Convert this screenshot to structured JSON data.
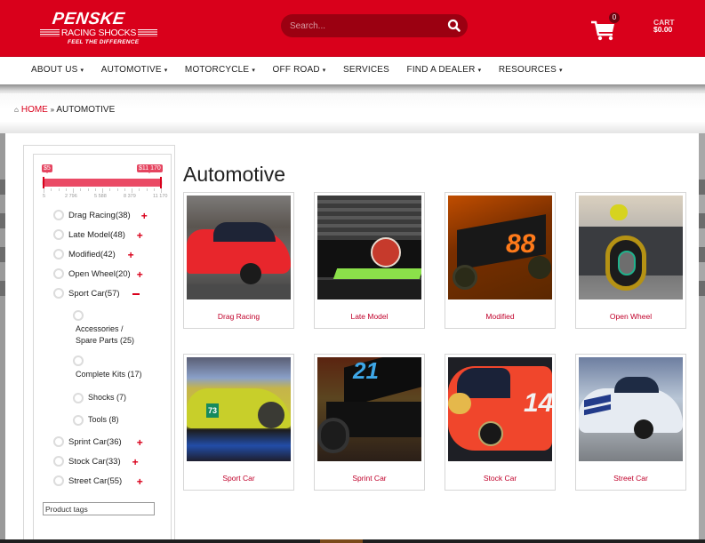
{
  "header": {
    "logo": {
      "brand": "PENSKE",
      "sub": "RACING SHOCKS",
      "tagline": "FEEL THE DIFFERENCE"
    },
    "search": {
      "placeholder": "Search...",
      "icon": "search-icon"
    },
    "cart": {
      "icon": "cart-icon",
      "count": "0",
      "label": "CART",
      "total": "$0.00"
    }
  },
  "nav": {
    "items": [
      {
        "label": "ABOUT US",
        "dropdown": true
      },
      {
        "label": "AUTOMOTIVE",
        "dropdown": true
      },
      {
        "label": "MOTORCYCLE",
        "dropdown": true
      },
      {
        "label": "OFF ROAD",
        "dropdown": true
      },
      {
        "label": "SERVICES",
        "dropdown": false
      },
      {
        "label": "FIND A DEALER",
        "dropdown": true
      },
      {
        "label": "RESOURCES",
        "dropdown": true
      }
    ],
    "caret": "▾"
  },
  "breadcrumb": {
    "icon": "home-icon",
    "home": "HOME",
    "separator": "»",
    "current": "AUTOMOTIVE"
  },
  "sidebar": {
    "price_filter": {
      "min_label": "$5",
      "max_label": "$11 170",
      "range_min": 5,
      "range_max": 11170,
      "selected_min_fraction": 0,
      "selected_max_fraction": 1,
      "tick_labels": [
        "5",
        "2 796",
        "5 588",
        "8 379",
        "11 170"
      ]
    },
    "categories": [
      {
        "label": "Drag Racing",
        "count": "(38)",
        "toggle": "+"
      },
      {
        "label": "Late Model",
        "count": "(48)",
        "toggle": "+"
      },
      {
        "label": "Modified",
        "count": "(42)",
        "toggle": "+"
      },
      {
        "label": "Open Wheel",
        "count": "(20)",
        "toggle": "+"
      },
      {
        "label": "Sport Car",
        "count": "(57)",
        "toggle": "−",
        "expanded": true
      }
    ],
    "subcategories": [
      {
        "label_line1": "Accessories /",
        "label_line2": "Spare Parts (25)"
      },
      {
        "label_line1": "Complete Kits (17)"
      },
      {
        "label_line1": "Shocks (7)"
      },
      {
        "label_line1": "Tools (8)"
      }
    ],
    "categories_after": [
      {
        "label": "Sprint Car",
        "count": "(36)",
        "toggle": "+"
      },
      {
        "label": "Stock Car",
        "count": "(33)",
        "toggle": "+"
      },
      {
        "label": "Street Car",
        "count": "(55)",
        "toggle": "+"
      }
    ],
    "tags_placeholder": "Product tags"
  },
  "main": {
    "title": "Automotive",
    "products": [
      {
        "name": "Drag Racing",
        "image": "red drag racing car"
      },
      {
        "name": "Late Model",
        "image": "black and green late model car"
      },
      {
        "name": "Modified",
        "image": "black and orange modified #88"
      },
      {
        "name": "Open Wheel",
        "image": "silver F1 open wheel car"
      },
      {
        "name": "Sport Car",
        "image": "yellow sport car #73"
      },
      {
        "name": "Sprint Car",
        "image": "black sprint car #21"
      },
      {
        "name": "Stock Car",
        "image": "orange stock car #14"
      },
      {
        "name": "Street Car",
        "image": "white mustang street car"
      }
    ]
  },
  "colors": {
    "brand_red": "#d9001b",
    "link_red": "#c0002a",
    "slider_red": "#ea4a65"
  }
}
